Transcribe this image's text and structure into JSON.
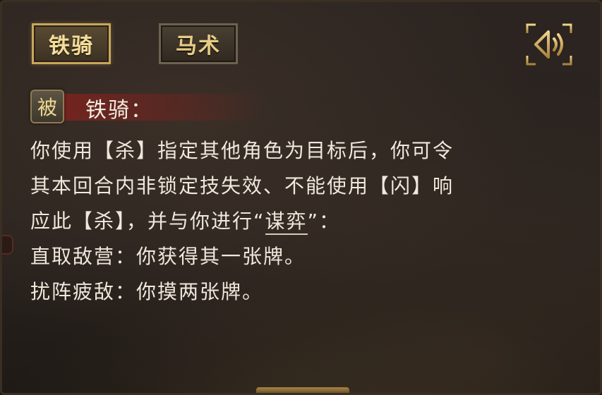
{
  "tabs": [
    {
      "label": "铁骑",
      "active": true
    },
    {
      "label": "马术",
      "active": false
    }
  ],
  "voice_button": {
    "icon": "speaker-icon"
  },
  "skill": {
    "type_badge": "被",
    "name": "铁骑："
  },
  "description": {
    "line1": "你使用【杀】指定其他角色为目标后，你可令",
    "line2": "其本回合内非锁定技失效、不能使用【闪】响",
    "line3_before": "应此【杀】，并与你进行“",
    "line3_keyword": "谋弈",
    "line3_after": "”：",
    "line4": "直取敌营：你获得其一张牌。",
    "line5": "扰阵疲敌：你摸两张牌。"
  },
  "colors": {
    "gold": "#c9a75a",
    "text": "#efe8dc",
    "skill_highlight": "#82231e"
  }
}
